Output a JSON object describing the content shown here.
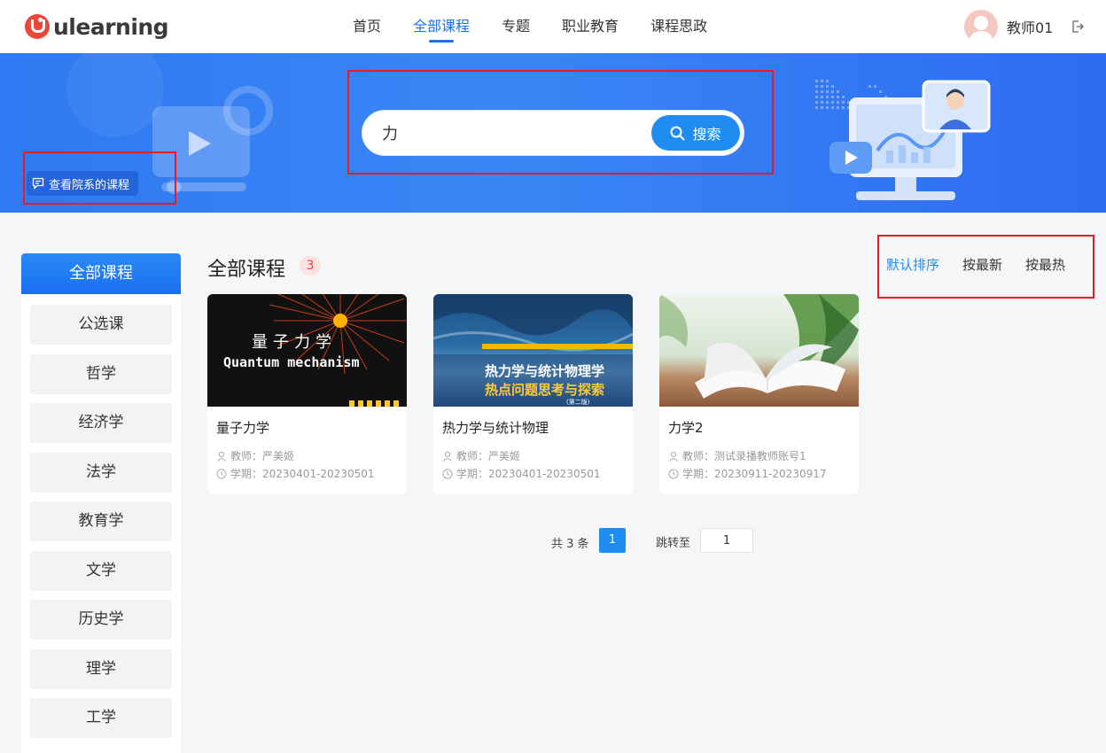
{
  "header": {
    "logo_text": "ulearning",
    "nav": [
      {
        "label": "首页"
      },
      {
        "label": "全部课程"
      },
      {
        "label": "专题"
      },
      {
        "label": "职业教育"
      },
      {
        "label": "课程思政"
      }
    ],
    "active_nav": "全部课程",
    "user_name": "教师01",
    "logout_icon": "logout-icon"
  },
  "banner": {
    "department_button": "查看院系的课程",
    "search_value": "力",
    "search_button": "搜索"
  },
  "sidebar": {
    "header": "全部课程",
    "items": [
      "公选课",
      "哲学",
      "经济学",
      "法学",
      "教育学",
      "文学",
      "历史学",
      "理学",
      "工学"
    ]
  },
  "main": {
    "title": "全部课程",
    "count": "3",
    "sort_options": [
      {
        "label": "默认排序"
      },
      {
        "label": "按最新"
      },
      {
        "label": "按最热"
      }
    ],
    "active_sort": "默认排序",
    "courses": [
      {
        "title": "量子力学",
        "cover_line1": "量子力学",
        "cover_line2": "Quantum mechanism",
        "teacher": "教师：严美姬",
        "term": "学期：20230401-20230501"
      },
      {
        "title": "热力学与统计物理",
        "cover_line1": "热力学与统计物理学",
        "cover_line2": "热点问题思考与探索",
        "cover_line3": "(第二版)",
        "teacher": "教师：严美姬",
        "term": "学期：20230401-20230501"
      },
      {
        "title": "力学2",
        "teacher": "教师：测试录播教师账号1",
        "term": "学期：20230911-20230917"
      }
    ]
  },
  "pagination": {
    "total": "共 3 条",
    "current_page": "1",
    "jump_label": "跳转至",
    "jump_value": "1"
  },
  "colors": {
    "accent": "#1e8cf0",
    "highlight_box": "#e51c23"
  }
}
